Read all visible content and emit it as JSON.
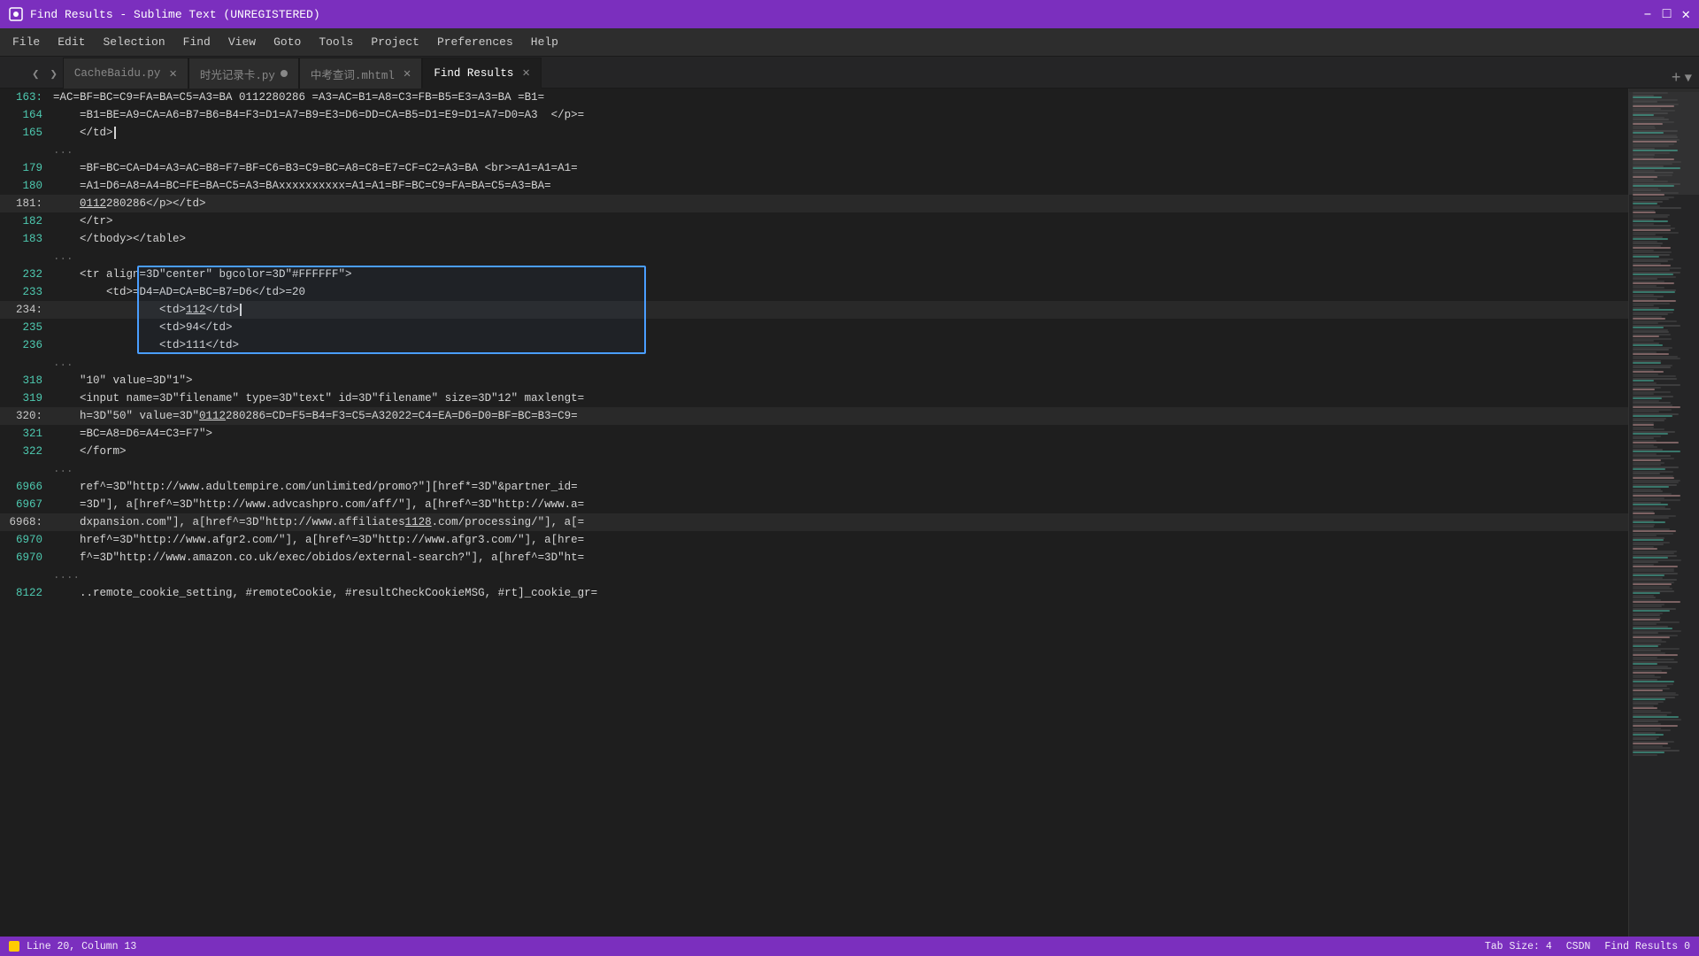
{
  "titleBar": {
    "title": "Find Results - Sublime Text (UNREGISTERED)",
    "controls": [
      "minimize",
      "maximize",
      "close"
    ]
  },
  "menuBar": {
    "items": [
      "File",
      "Edit",
      "Selection",
      "Find",
      "View",
      "Goto",
      "Tools",
      "Project",
      "Preferences",
      "Help"
    ]
  },
  "tabs": [
    {
      "id": "cachebaidu",
      "label": "CacheBaidu.py",
      "modified": false,
      "active": false
    },
    {
      "id": "shiguijilu",
      "label": "时光记录卡.py",
      "modified": true,
      "active": false
    },
    {
      "id": "zhongkao",
      "label": "中考查词.mhtml",
      "modified": false,
      "active": false
    },
    {
      "id": "findresults",
      "label": "Find Results",
      "modified": false,
      "active": true
    }
  ],
  "codeLines": [
    {
      "num": "163",
      "indent": "",
      "content": "=AC=BF=BC=C9=FA=BA=C5=A3=BA 0112280286 =A3=AC=B1=A8=C3=FB=B5=E3=A3=BA =B1=",
      "highlight": false,
      "cursor": false
    },
    {
      "num": "164",
      "indent": "",
      "content": "=B1=BE=A9=CA=A6=B7=B6=B4=F3=D1=A7=B9=E3=D6=DD=CA=B5=D1=E9=D1=A7=D0=A3  </p>=",
      "highlight": false,
      "cursor": false
    },
    {
      "num": "165",
      "indent": "",
      "content": "    </td>",
      "highlight": false,
      "cursor": false
    },
    {
      "num": "...",
      "indent": "",
      "content": "",
      "highlight": false,
      "cursor": false,
      "dots": true
    },
    {
      "num": "179",
      "indent": "",
      "content": "=BF=BC=CA=D4=A3=AC=B8=F7=BF=C6=B3=C9=BC=A8=C8=E7=CF=C2=A3=BA <br>=A1=A1=A1=",
      "highlight": false,
      "cursor": false
    },
    {
      "num": "180",
      "indent": "",
      "content": "=A1=D6=A8=A4=BC=FE=BA=C5=A3=BAxxxxxxxxxx=A1=A1=BF=BC=C9=FA=BA=C5=A3=BA=",
      "highlight": false,
      "cursor": false
    },
    {
      "num": "181",
      "indent": "",
      "content": "0112280286</p></td>",
      "highlight": false,
      "cursor": false,
      "lineHighlight": true
    },
    {
      "num": "182",
      "indent": "",
      "content": "    </tr>",
      "highlight": false,
      "cursor": false
    },
    {
      "num": "183",
      "indent": "",
      "content": "    </tbody></table>",
      "highlight": false,
      "cursor": false
    },
    {
      "num": "...",
      "indent": "",
      "content": "",
      "highlight": false,
      "cursor": false,
      "dots": true
    },
    {
      "num": "232",
      "indent": "",
      "content": "    <tr align=3D\"center\" bgcolor=3D\"#FFFFFF\">",
      "highlight": false,
      "cursor": false,
      "boxStart": true
    },
    {
      "num": "233",
      "indent": "",
      "content": "        <td>=D4=AD=CA=BC=B7=D6</td>=20",
      "highlight": false,
      "cursor": false,
      "inBox": true
    },
    {
      "num": "234",
      "indent": "",
      "content": "                <td>112</td>",
      "highlight": false,
      "cursor": true,
      "inBox": true,
      "lineHighlight": true
    },
    {
      "num": "235",
      "indent": "",
      "content": "                <td>94</td>",
      "highlight": false,
      "cursor": false,
      "inBox": true
    },
    {
      "num": "236",
      "indent": "",
      "content": "                <td>111</td>",
      "highlight": false,
      "cursor": false,
      "boxEnd": true
    },
    {
      "num": "...",
      "indent": "",
      "content": "",
      "highlight": false,
      "cursor": false,
      "dots": true
    },
    {
      "num": "318",
      "indent": "",
      "content": "    \"10\" value=3D\"1\">",
      "highlight": false,
      "cursor": false
    },
    {
      "num": "319",
      "indent": "",
      "content": "    <input name=3D\"filename\" type=3D\"text\" id=3D\"filename\" size=3D\"12\" maxlengt=",
      "highlight": false,
      "cursor": false
    },
    {
      "num": "320",
      "indent": "",
      "content": "h=3D\"50\" value=3D\"0112280286=CD=F5=B4=F3=C5=A32022=C4=EA=D6=D0=BF=BC=B3=C9=",
      "highlight": false,
      "cursor": false,
      "lineHighlight": true
    },
    {
      "num": "321",
      "indent": "",
      "content": "=BC=A8=D6=A4=C3=F7\">",
      "highlight": false,
      "cursor": false
    },
    {
      "num": "322",
      "indent": "",
      "content": "    </form>",
      "highlight": false,
      "cursor": false
    },
    {
      "num": "...",
      "indent": "",
      "content": "",
      "highlight": false,
      "cursor": false,
      "dots": true
    },
    {
      "num": "6966",
      "indent": "",
      "content": "    ref^=3D\"http://www.adultempire.com/unlimited/promo?\"][href*=3D\"&partner_id=",
      "highlight": false,
      "cursor": false
    },
    {
      "num": "6967",
      "indent": "",
      "content": "    =3D\"], a[href^=3D\"http://www.advcashpro.com/aff/\"], a[href^=3D\"http://www.a=",
      "highlight": false,
      "cursor": false
    },
    {
      "num": "6968",
      "indent": "",
      "content": "    dxpansion.com\"], a[href^=3D\"http://www.affiliates1128.com/processing/\"], a[=",
      "highlight": false,
      "cursor": false,
      "lineHighlight": true
    },
    {
      "num": "6970",
      "indent": "",
      "content": "    href^=3D\"http://www.afgr2.com/\"], a[href^=3D\"http://www.afgr3.com/\"], a[hre=",
      "highlight": false,
      "cursor": false
    },
    {
      "num": "6970",
      "indent": "",
      "content": "    f^=3D\"http://www.amazon.co.uk/exec/obidos/external-search?\"], a[href^=3D\"ht=",
      "highlight": false,
      "cursor": false
    },
    {
      "num": "....",
      "indent": "",
      "content": "",
      "highlight": false,
      "cursor": false,
      "dots": true
    },
    {
      "num": "8122",
      "indent": "",
      "content": "    ..remote_cookie_setting, #remoteCookie, #resultCheckCookieMSG, #rt]_cookie_gr=",
      "highlight": false,
      "cursor": false
    }
  ],
  "statusBar": {
    "position": "Line 20, Column 13",
    "encoding": "",
    "tabSize": "Tab Size: 4",
    "platform": "CSDN",
    "info": "Find Results 0"
  },
  "minimap": {
    "visible": true
  }
}
